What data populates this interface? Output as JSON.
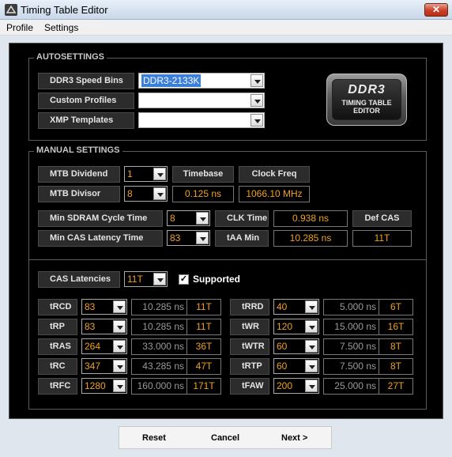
{
  "window": {
    "title": "Timing Table Editor",
    "close": "✕"
  },
  "menu": [
    "Profile",
    "Settings"
  ],
  "auto": {
    "title": "AUTOSETTINGS",
    "rows": [
      {
        "label": "DDR3 Speed Bins",
        "value": "DDR3-2133K"
      },
      {
        "label": "Custom Profiles",
        "value": ""
      },
      {
        "label": "XMP Templates",
        "value": ""
      }
    ],
    "logo": {
      "line1": "DDR3",
      "line2": "TIMING TABLE",
      "line3": "EDITOR"
    }
  },
  "manual": {
    "title": "MANUAL SETTINGS",
    "mtb_dividend": {
      "label": "MTB Dividend",
      "value": "1"
    },
    "mtb_divisor": {
      "label": "MTB Divisor",
      "value": "8"
    },
    "timebase": {
      "label": "Timebase",
      "value": "0.125 ns"
    },
    "clock_freq": {
      "label": "Clock Freq",
      "value": "1066.10 MHz"
    },
    "min_cycle": {
      "label": "Min SDRAM Cycle Time",
      "value": "8"
    },
    "min_cas": {
      "label": "Min CAS Latency Time",
      "value": "83"
    },
    "clk_time": {
      "label": "CLK Time",
      "value": "0.938 ns"
    },
    "taa_min": {
      "label": "tAA Min",
      "value": "10.285 ns"
    },
    "def_cas": {
      "label": "Def CAS",
      "value": "11T"
    },
    "cas_latencies": {
      "label": "CAS Latencies",
      "value": "11T",
      "supported_label": "Supported",
      "supported_mark": "✓"
    },
    "timings_left": [
      {
        "label": "tRCD",
        "value": "83",
        "ns": "10.285 ns",
        "t": "11T"
      },
      {
        "label": "tRP",
        "value": "83",
        "ns": "10.285 ns",
        "t": "11T"
      },
      {
        "label": "tRAS",
        "value": "264",
        "ns": "33.000 ns",
        "t": "36T"
      },
      {
        "label": "tRC",
        "value": "347",
        "ns": "43.285 ns",
        "t": "47T"
      },
      {
        "label": "tRFC",
        "value": "1280",
        "ns": "160.000 ns",
        "t": "171T"
      }
    ],
    "timings_right": [
      {
        "label": "tRRD",
        "value": "40",
        "ns": "5.000 ns",
        "t": "6T"
      },
      {
        "label": "tWR",
        "value": "120",
        "ns": "15.000 ns",
        "t": "16T"
      },
      {
        "label": "tWTR",
        "value": "60",
        "ns": "7.500 ns",
        "t": "8T"
      },
      {
        "label": "tRTP",
        "value": "60",
        "ns": "7.500 ns",
        "t": "8T"
      },
      {
        "label": "tFAW",
        "value": "200",
        "ns": "25.000 ns",
        "t": "27T"
      }
    ]
  },
  "buttons": {
    "reset": "Reset",
    "cancel": "Cancel",
    "next": "Next >"
  }
}
